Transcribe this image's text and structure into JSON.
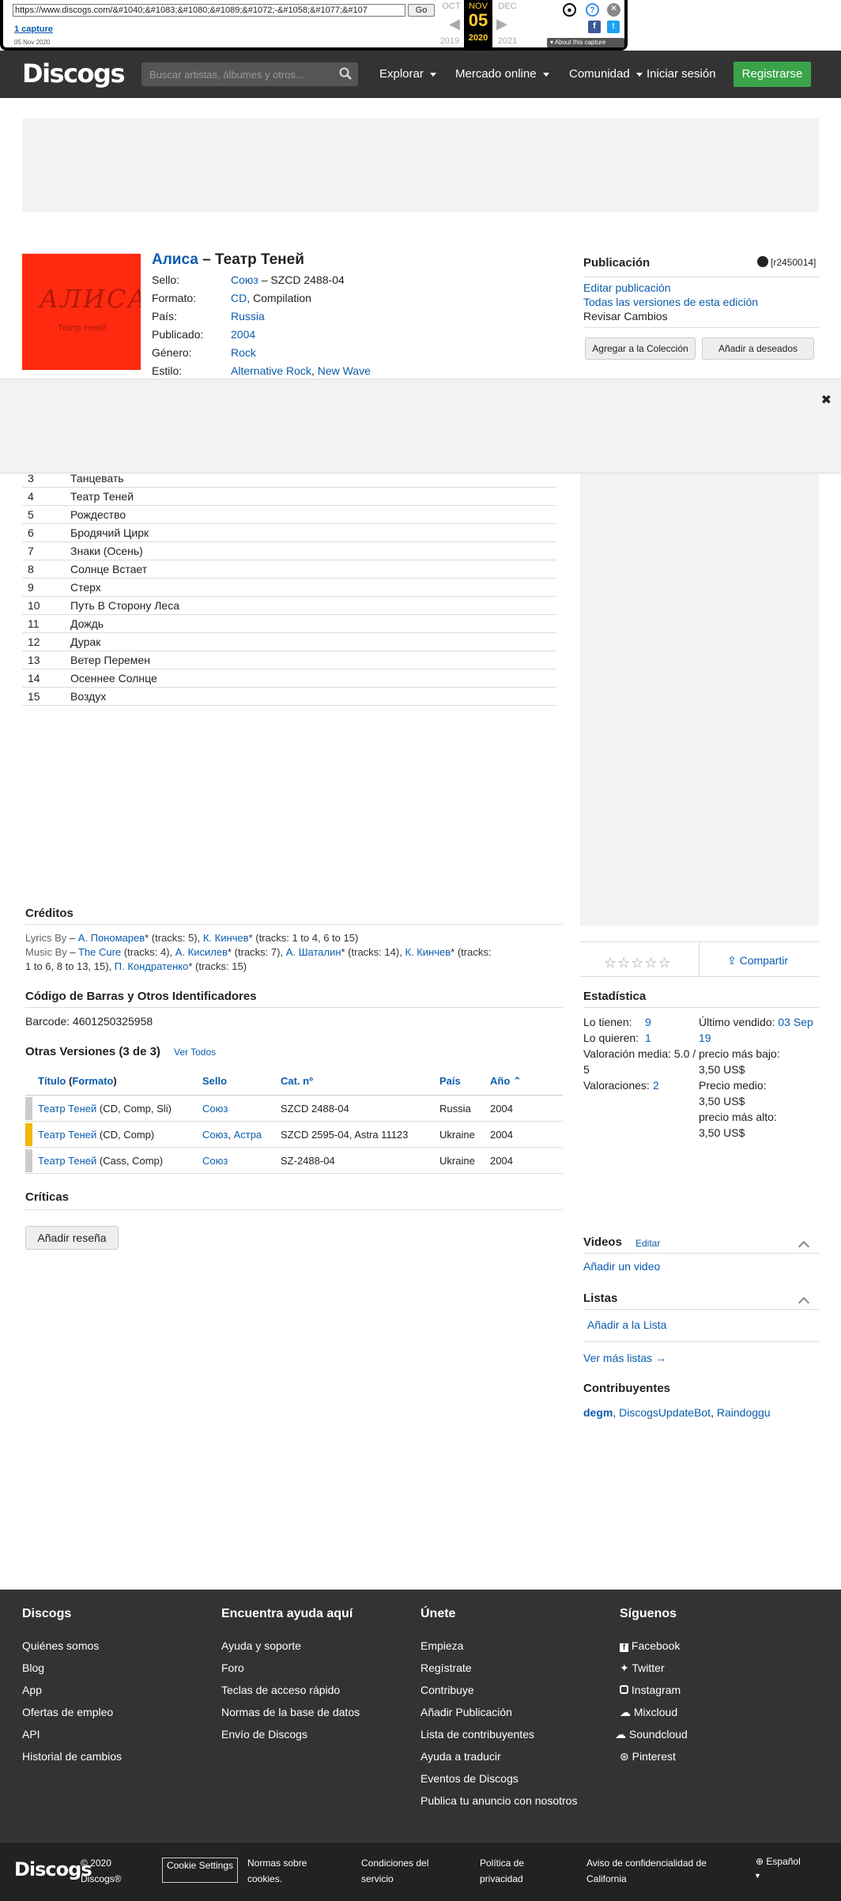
{
  "wayback": {
    "url": "https://www.discogs.com/&#1040;&#1083;&#1080;&#1089;&#1072;-&#1058;&#1077;&#107",
    "go": "Go",
    "captures": "1 capture",
    "capture_date": "05 Nov 2020",
    "prev_month": "OCT",
    "cur_month": "NOV",
    "next_month": "DEC",
    "day": "05",
    "prev_year": "2019",
    "cur_year": "2020",
    "next_year": "2021",
    "about": "About this capture"
  },
  "header": {
    "logo": "Discogs",
    "search_placeholder": "Buscar artistas, álbumes y otros...",
    "explore": "Explorar",
    "market": "Mercado online",
    "community": "Comunidad",
    "login": "Iniciar sesión",
    "register": "Registrarse"
  },
  "release": {
    "artist": "Алиса",
    "sep": " – ",
    "title": "Театр Теней",
    "cover_text": "АЛИСА",
    "cover_sub": "Театр теней",
    "label_key": "Sello:",
    "label_link": "Союз",
    "label_cat": " – SZCD 2488-04",
    "format_key": "Formato:",
    "format_link": "CD",
    "format_rest": ", Compilation",
    "country_key": "País:",
    "country": "Russia",
    "released_key": "Publicado:",
    "released": "2004",
    "genre_key": "Género:",
    "genre": "Rock",
    "style_key": "Estilo:",
    "style1": "Alternative Rock",
    "style_sep": ", ",
    "style2": "New Wave"
  },
  "sidebar": {
    "heading": "Publicación",
    "release_code": "[r2450014]",
    "edit": "Editar publicación",
    "all_versions": "Todas las versiones de esta edición",
    "review_changes": "Revisar Cambios",
    "add_collection": "Agregar a la Colección",
    "add_wantlist": "Añadir a deseados",
    "share": "Compartir",
    "stars": "☆☆☆☆☆"
  },
  "tracklist": [
    {
      "n": "3",
      "t": "Танцевать"
    },
    {
      "n": "4",
      "t": "Театр Теней"
    },
    {
      "n": "5",
      "t": "Рождество"
    },
    {
      "n": "6",
      "t": "Бродячий Цирк"
    },
    {
      "n": "7",
      "t": "Знаки (Осень)"
    },
    {
      "n": "8",
      "t": "Солнце Встает"
    },
    {
      "n": "9",
      "t": "Стерх"
    },
    {
      "n": "10",
      "t": "Путь В Сторону Леса"
    },
    {
      "n": "11",
      "t": "Дождь"
    },
    {
      "n": "12",
      "t": "Дурак"
    },
    {
      "n": "13",
      "t": "Ветер Перемен"
    },
    {
      "n": "14",
      "t": "Осеннее Солнце"
    },
    {
      "n": "15",
      "t": "Воздух"
    }
  ],
  "credits": {
    "heading": "Créditos",
    "lyrics_role": "Lyrics By",
    "lyrics_p1": "А. Пономарев",
    "lyrics_t1": "* (tracks: 5), ",
    "lyrics_p2": "К. Кинчев",
    "lyrics_t2": "* (tracks: 1 to 4, 6 to 15)",
    "music_role": "Music By",
    "music_p1": "The Cure",
    "music_t1": " (tracks: 4), ",
    "music_p2": "А. Кисилев",
    "music_t2": "* (tracks: 7), ",
    "music_p3": "А. Шаталин",
    "music_t3": "* (tracks: 14), ",
    "music_p4": "К. Кинчев",
    "music_t4": "* (tracks:",
    "music_l2a": "1 to 6, 8 to 13, 15), ",
    "music_p5": "П. Кондратенко",
    "music_t5": "* (tracks: 15)"
  },
  "barcode": {
    "heading": "Código de Barras y Otros Identificadores",
    "text": "Barcode: 4601250325958"
  },
  "versions": {
    "heading": "Otras Versiones (3 de 3)",
    "see_all": "Ver Todos",
    "col_title": "Título",
    "col_format": "Formato",
    "col_label": "Sello",
    "col_cat": "Cat. nº",
    "col_country": "País",
    "col_year": "Año",
    "rows": [
      {
        "title": "Театр Теней",
        "format": " (CD, Comp, Sli)",
        "label": "Союз",
        "label2": "",
        "cat": "SZCD 2488-04",
        "country": "Russia",
        "year": "2004",
        "bar": "#cccccc"
      },
      {
        "title": "Театр Теней",
        "format": " (CD, Comp)",
        "label": "Союз",
        "label2": "Астра",
        "cat": "SZCD 2595-04, Astra 11123",
        "country": "Ukraine",
        "year": "2004",
        "bar": "#f2b800"
      },
      {
        "title": "Театр Теней",
        "format": " (Cass, Comp)",
        "label": "Союз",
        "label2": "",
        "cat": "SZ-2488-04",
        "country": "Ukraine",
        "year": "2004",
        "bar": "#cccccc"
      }
    ]
  },
  "reviews": {
    "heading": "Críticas",
    "add": "Añadir reseña"
  },
  "stats": {
    "heading": "Estadística",
    "have_k": "Lo tienen:",
    "have": "9",
    "want_k": "Lo quieren:",
    "want": "1",
    "avg_k": "Valoración media:",
    "avg": "5.0 /",
    "avg2": "5",
    "ratings_k": "Valoraciones:",
    "ratings": "2",
    "last_sold_k": "Último vendido:",
    "last_sold": "03 Sep",
    "last_sold2": "19",
    "low_k": "precio más bajo:",
    "low": "3,50 US$",
    "med_k": "Precio medio:",
    "med": "3,50 US$",
    "high_k": "precio más alto:",
    "high": "3,50 US$"
  },
  "videos": {
    "heading": "Videos",
    "edit": "Editar",
    "add": "Añadir un video"
  },
  "lists": {
    "heading": "Listas",
    "add": "Añadir a la Lista",
    "more": "Ver más listas →"
  },
  "contributors": {
    "heading": "Contribuyentes",
    "c1": "degm",
    "c2": "DiscogsUpdateBot",
    "c3": "Raindoggu"
  },
  "footer": {
    "col1": {
      "h": "Discogs",
      "items": [
        "Quiénes somos",
        "Blog",
        "App",
        "Ofertas de empleo",
        "API",
        "Historial de cambios"
      ]
    },
    "col2": {
      "h": "Encuentra ayuda aquí",
      "items": [
        "Ayuda y soporte",
        "Foro",
        "Teclas de acceso rápido",
        "Normas de la base de datos",
        "Envío de Discogs"
      ]
    },
    "col3": {
      "h": "Únete",
      "items": [
        "Empieza",
        "Regístrate",
        "Contribuye",
        "Añadir Publicación",
        "Lista de contribuyentes",
        "Ayuda a traducir",
        "Eventos de Discogs",
        "Publica tu anuncio con nosotros"
      ]
    },
    "col4": {
      "h": "Síguenos",
      "items": [
        "Facebook",
        "Twitter",
        "Instagram",
        "Mixcloud",
        "Soundcloud",
        "Pinterest"
      ]
    }
  },
  "bottom": {
    "logo": "Discogs",
    "copy1": "© 2020",
    "copy2": "Discogs®",
    "cookie": "Cookie Settings",
    "cookies1": "Normas sobre",
    "cookies2": "cookies.",
    "terms1": "Condiciones del",
    "terms2": "servicio",
    "privacy1": "Política de",
    "privacy2": "privacidad",
    "ca1": "Aviso de confidencialidad de",
    "ca2": "California",
    "lang": "Español"
  }
}
